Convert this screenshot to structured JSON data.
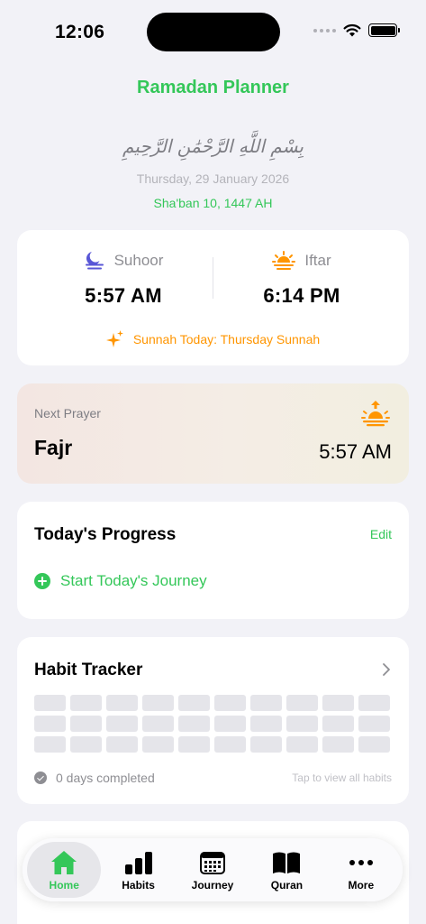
{
  "status_bar": {
    "time": "12:06"
  },
  "header": {
    "title": "Ramadan Planner",
    "bismillah": "بِسْمِ اللَّهِ الرَّحْمَٰنِ الرَّحِيمِ",
    "date": "Thursday, 29 January 2026",
    "hijri_date": "Sha'ban 10, 1447 AH"
  },
  "times": {
    "suhoor": {
      "label": "Suhoor",
      "time": "5:57 AM"
    },
    "iftar": {
      "label": "Iftar",
      "time": "6:14 PM"
    },
    "sunnah": "Sunnah Today: Thursday Sunnah"
  },
  "next_prayer": {
    "label": "Next Prayer",
    "name": "Fajr",
    "time": "5:57 AM"
  },
  "progress": {
    "title": "Today's Progress",
    "edit": "Edit",
    "start": "Start Today's Journey"
  },
  "habits": {
    "title": "Habit Tracker",
    "completed": "0 days completed",
    "hint": "Tap to view all habits",
    "cells": 30
  },
  "tabs": [
    {
      "label": "Home",
      "icon": "home-icon",
      "active": true
    },
    {
      "label": "Habits",
      "icon": "bar-chart-icon",
      "active": false
    },
    {
      "label": "Journey",
      "icon": "calendar-icon",
      "active": false
    },
    {
      "label": "Quran",
      "icon": "book-icon",
      "active": false
    },
    {
      "label": "More",
      "icon": "more-icon",
      "active": false
    }
  ],
  "colors": {
    "accent": "#34c759",
    "orange": "#ff9500",
    "purple": "#5856d6",
    "background": "#f2f2f7"
  }
}
